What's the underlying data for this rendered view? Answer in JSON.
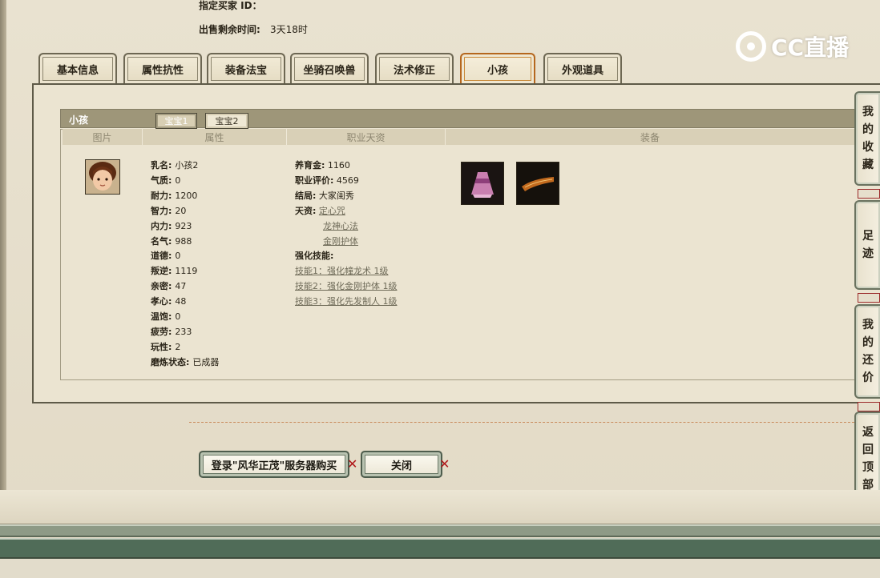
{
  "header": {
    "seller_id_label": "指定买家 ID：",
    "time_left_label": "出售剩余时间:",
    "time_left_value": "3天18时"
  },
  "logo": {
    "text": "CC直播"
  },
  "tabs": [
    {
      "label": "基本信息"
    },
    {
      "label": "属性抗性"
    },
    {
      "label": "装备法宝"
    },
    {
      "label": "坐骑召唤兽"
    },
    {
      "label": "法术修正"
    },
    {
      "label": "小孩",
      "active": true
    },
    {
      "label": "外观道具"
    }
  ],
  "child_panel": {
    "title": "小孩",
    "sub_tabs": [
      {
        "label": "宝宝1"
      },
      {
        "label": "宝宝2",
        "active": true
      }
    ],
    "columns": {
      "image": "图片",
      "attributes": "属性",
      "talent": "职业天资",
      "equipment": "装备"
    },
    "attributes": [
      {
        "label": "乳名:",
        "value": "小孩2"
      },
      {
        "label": "气质:",
        "value": "0"
      },
      {
        "label": "耐力:",
        "value": "1200"
      },
      {
        "label": "智力:",
        "value": "20"
      },
      {
        "label": "内力:",
        "value": "923"
      },
      {
        "label": "名气:",
        "value": "988"
      },
      {
        "label": "道德:",
        "value": "0"
      },
      {
        "label": "叛逆:",
        "value": "1119"
      },
      {
        "label": "亲密:",
        "value": "47"
      },
      {
        "label": "孝心:",
        "value": "48"
      },
      {
        "label": "温饱:",
        "value": "0"
      },
      {
        "label": "疲劳:",
        "value": "233"
      },
      {
        "label": "玩性:",
        "value": "2"
      },
      {
        "label": "磨炼状态:",
        "value": "已成器"
      }
    ],
    "talent": {
      "yangyujin_label": "养育金:",
      "yangyujin_value": "1160",
      "pingjia_label": "职业评价:",
      "pingjia_value": "4569",
      "jieju_label": "结局:",
      "jieju_value": "大家闺秀",
      "tianzi_label": "天资:",
      "tianzi_items": [
        "定心咒",
        "龙神心法",
        "金刚护体"
      ],
      "skills_label": "强化技能:",
      "skills": [
        "技能1：强化幢龙术 1级",
        "技能2：强化金刚护体 1级",
        "技能3：强化先发制人 1级"
      ]
    }
  },
  "buttons": {
    "buy": "登录\"风华正茂\"服务器购买",
    "close": "关闭"
  },
  "side_nav": [
    {
      "label": "我的收藏",
      "chars": [
        "我",
        "的",
        "收",
        "藏"
      ]
    },
    {
      "label": "足迹",
      "chars": [
        "足",
        "迹"
      ]
    },
    {
      "label": "我的还价",
      "chars": [
        "我",
        "的",
        "还",
        "价"
      ]
    },
    {
      "label": "返回顶部",
      "chars": [
        "返",
        "回",
        "顶",
        "部"
      ]
    }
  ],
  "colors": {
    "accent_tab": "#c98a3a",
    "close_x": "#b0181a",
    "footer_green": "#506c58"
  }
}
